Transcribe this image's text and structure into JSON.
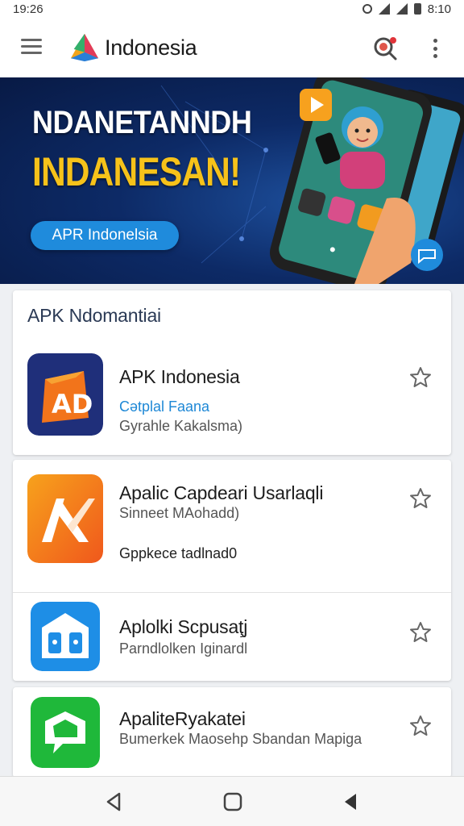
{
  "status_bar": {
    "time": "19:26",
    "clock_right": "8:10"
  },
  "app_bar": {
    "title": "Indonesia",
    "icons": [
      "menu-icon",
      "logo-icon",
      "search-icon",
      "more-icon"
    ]
  },
  "banner": {
    "headline_1": "NDANETANNDH",
    "headline_2": "INDANESAN!",
    "cta": "APR Indonelsia",
    "colors": {
      "headline_2": "#f6c21a",
      "cta_bg": "#1f8bdc"
    }
  },
  "section": {
    "title": "APK Ndomantiai",
    "apps": [
      {
        "name": "APK Indonesia",
        "line1": "Cətplal Faana",
        "line2": "Gyrahle Kakalsma)"
      }
    ]
  },
  "apps": [
    {
      "name": "Apalic Capdeari Usarlaqli",
      "line1": "Sinneet MAohadd)",
      "line2": "Gppkece tadlnad0"
    },
    {
      "name": "Aplolki Scpusaţj",
      "line1": "Parndlolken Iginardl"
    },
    {
      "name": "ApaliteRyakatei",
      "line1": "Bumerkek Maosehp Sbandan Mapiga"
    }
  ]
}
